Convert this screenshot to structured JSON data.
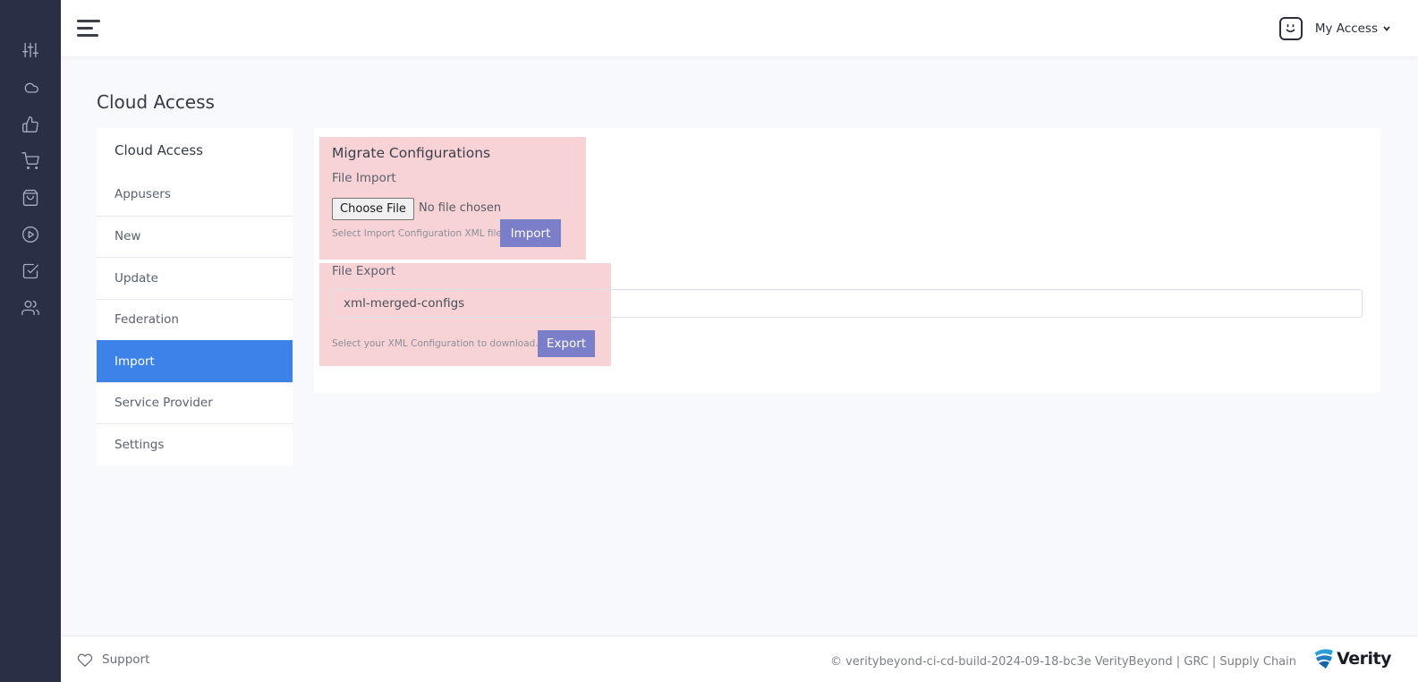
{
  "rail": {
    "icons": [
      "sliders-icon",
      "cloud-icon",
      "thumbs-up-icon",
      "cart-icon",
      "shopping-bag-icon",
      "play-circle-icon",
      "check-square-icon",
      "users-icon"
    ]
  },
  "header": {
    "user_menu_label": "My Access"
  },
  "page": {
    "title": "Cloud Access"
  },
  "menu": {
    "heading": "Cloud Access",
    "items": [
      {
        "label": "Appusers"
      },
      {
        "label": "New"
      },
      {
        "label": "Update"
      },
      {
        "label": "Federation"
      },
      {
        "label": "Import"
      },
      {
        "label": "Service Provider"
      },
      {
        "label": "Settings"
      }
    ],
    "active_index": 4
  },
  "migrate": {
    "title": "Migrate Configurations",
    "import": {
      "label": "File Import",
      "choose_label": "Choose File",
      "no_file_text": "No file chosen",
      "hint": "Select Import Configuration XML file",
      "button_label": "Import"
    },
    "export": {
      "label": "File Export",
      "input_value": "xml-merged-configs",
      "hint": "Select your XML Configuration to download.",
      "button_label": "Export"
    }
  },
  "footer": {
    "support_label": "Support",
    "copyright": "© veritybeyond-ci-cd-build-2024-09-18-bc3e VerityBeyond | GRC | Supply Chain",
    "brand": "Verity"
  },
  "colors": {
    "rail_bg": "#2a2f45",
    "active_menu": "#3d82e8",
    "primary_button": "#7b7ec8",
    "highlight": "#f8d3d6"
  }
}
